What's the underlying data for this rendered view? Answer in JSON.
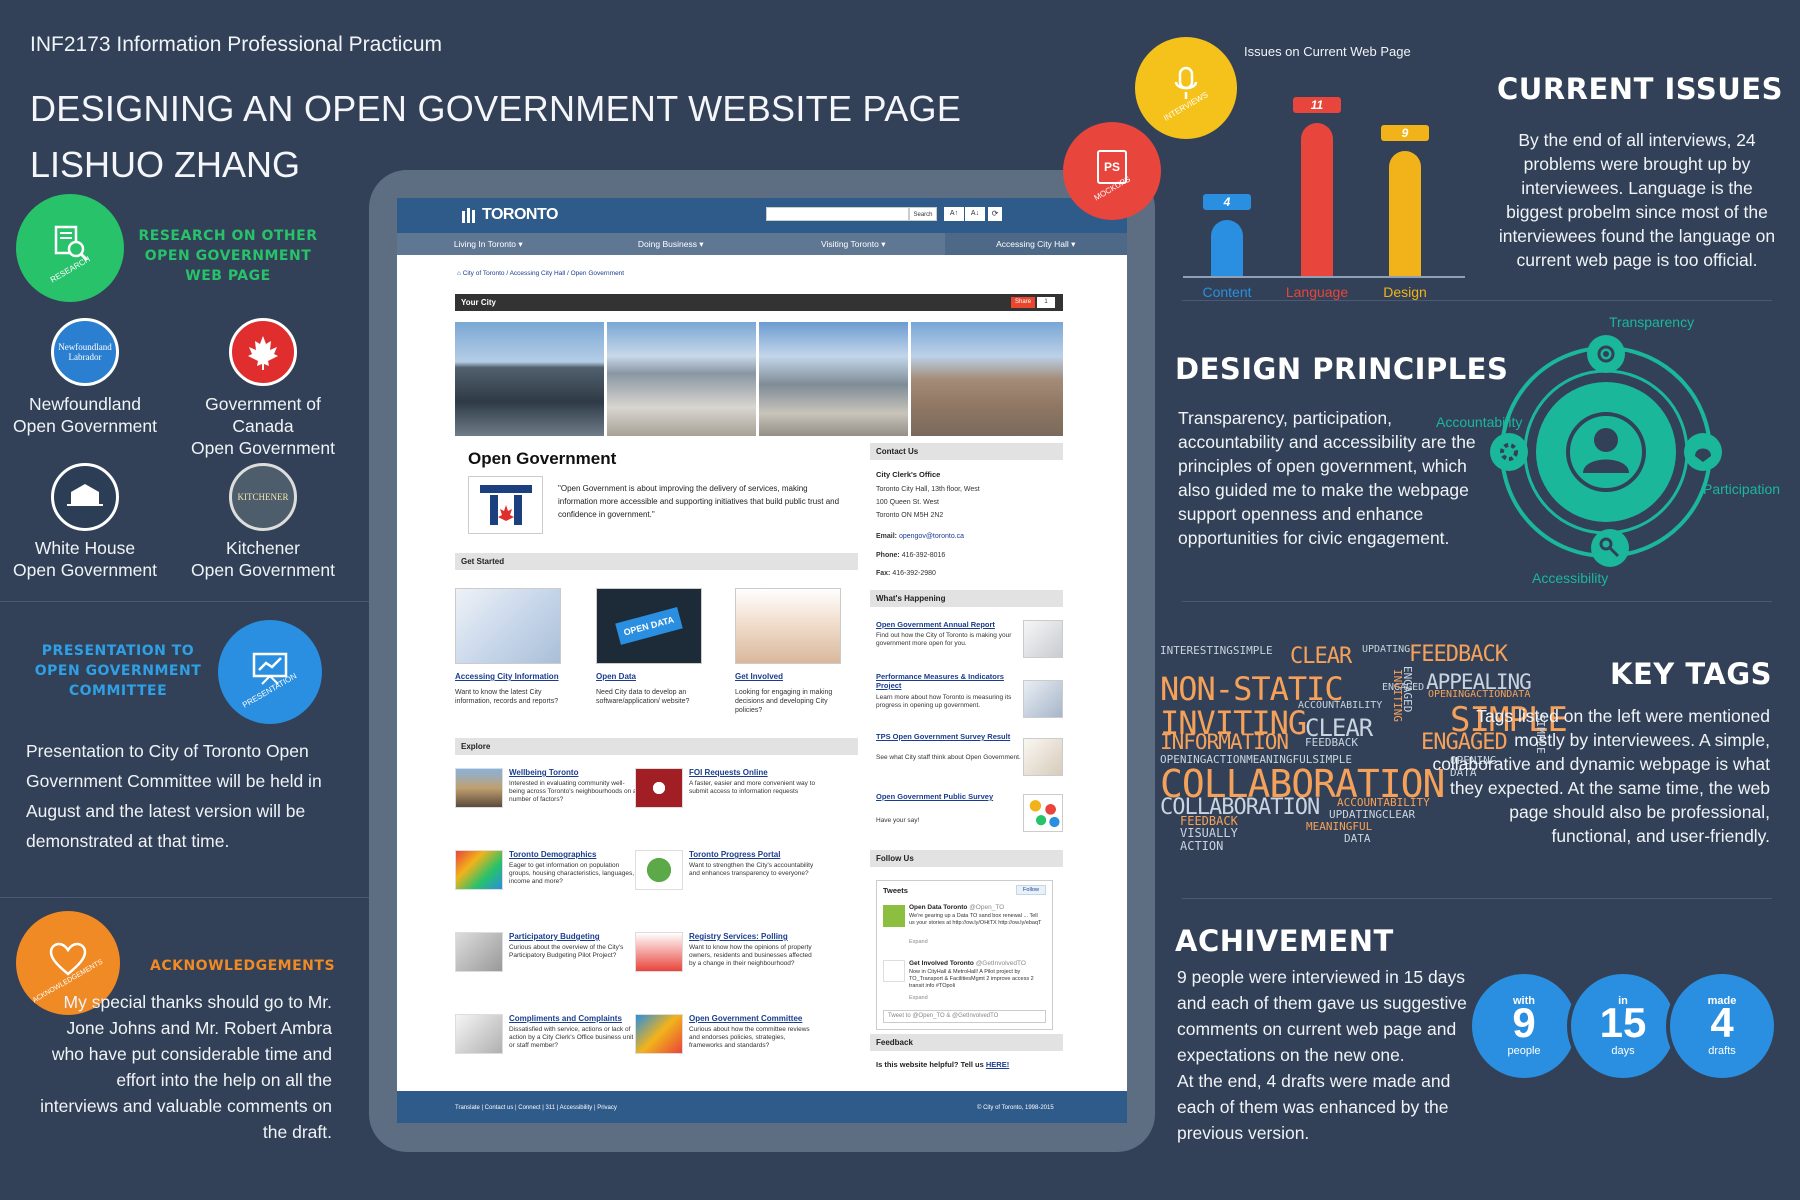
{
  "header": {
    "course": "INF2173 Information Professional Practicum",
    "title": "DESIGNING AN OPEN GOVERNMENT WEBSITE PAGE",
    "author": "LISHUO ZHANG"
  },
  "research": {
    "badge": "RESEARCH",
    "title": "RESEARCH ON OTHER\nOPEN GOVERNMENT\nWEB PAGE",
    "logos": [
      {
        "l1": "Newfoundland",
        "l2": "Open Government",
        "icon": "Newfoundland Labrador"
      },
      {
        "l1": "Government of Canada",
        "l2": "Open Government",
        "icon": "maple-leaf"
      },
      {
        "l1": "White House",
        "l2": "Open Government",
        "icon": "THE WHITE HOUSE"
      },
      {
        "l1": "Kitchener",
        "l2": "Open Government",
        "icon": "KITCHENER"
      }
    ]
  },
  "presentation": {
    "badge": "PRESENTATION",
    "title": "PRESENTATION TO\nOPEN GOVERNMENT\nCOMMITTEE",
    "text": "Presentation to City of Toronto Open Government Committee will be held in August and the latest version will be demonstrated at that time."
  },
  "ack": {
    "badge": "ACKNOWLEDGEMENTS",
    "title": "ACKNOWLEDGEMENTS",
    "text": "My special thanks should go to Mr. Jone Johns and Mr. Robert Ambra who have put considerable time and effort into the help on all the interviews and valuable comments on the draft."
  },
  "badges": {
    "interviews": "INTERVIEWS",
    "mockups": "MOCKUPS",
    "ps": "PS"
  },
  "site": {
    "logo": "TORONTO",
    "search_placeholder": "",
    "search_btn": "Search",
    "font_up": "A↑",
    "font_down": "A↓",
    "nav": [
      "Living In Toronto ▾",
      "Doing Business ▾",
      "Visiting Toronto ▾",
      "Accessing City Hall ▾"
    ],
    "breadcrumb": "⌂  City of Toronto  /  Accessing City Hall  /  Open Government",
    "yourcity": "Your City",
    "share": "Share",
    "share_count": "1",
    "page_title": "Open Government",
    "quote": "\"Open Government is about improving the delivery of services, making information more accessible and supporting initiatives that build public trust and confidence in government.\"",
    "contact": {
      "header": "Contact Us",
      "office": "City Clerk's Office",
      "addr1": "Toronto City Hall, 13th floor, West",
      "addr2": "100 Queen St. West",
      "addr3": "Toronto ON M5H 2N2",
      "email_lbl": "Email:",
      "email": "opengov@toronto.ca",
      "phone_lbl": "Phone:",
      "phone": "416-392-8016",
      "fax_lbl": "Fax:",
      "fax": "416-392-2980"
    },
    "get_started": {
      "header": "Get Started",
      "items": [
        {
          "title": "Accessing City Information",
          "desc": "Want to know the latest City information, records and reports?"
        },
        {
          "title": "Open Data",
          "desc": "Need City data to develop an software/application/ website?"
        },
        {
          "title": "Get Involved",
          "desc": "Looking for engaging in making decisions and developing City policies?"
        }
      ],
      "open_data_img": "OPEN DATA"
    },
    "happening": {
      "header": "What's Happening",
      "items": [
        {
          "title": "Open Government Annual Report",
          "desc": "Find out how the City of Toronto is making your government more open for you."
        },
        {
          "title": "Performance Measures & Indicators Project",
          "desc": "Learn more about how Toronto is measuring its progress in opening up government."
        },
        {
          "title": "TPS Open Government Survey Result",
          "desc": "See what City staff think about Open Government."
        },
        {
          "title": "Open Government Public Survey",
          "desc": "Have your say!"
        }
      ]
    },
    "explore": {
      "header": "Explore",
      "items": [
        {
          "title": "Wellbeing Toronto",
          "desc": "Interested in evaluating community well-being across Toronto's neighbourhoods on a number of factors?"
        },
        {
          "title": "FOI Requests Online",
          "desc": "A faster, easier and more convenient way to submit access to information requests"
        },
        {
          "title": "Toronto Demographics",
          "desc": "Eager to get information on population groups, housing characteristics, languages, income and more?"
        },
        {
          "title": "Toronto Progress Portal",
          "desc": "Want to strengthen the City's accountability and enhances transparency to everyone?"
        },
        {
          "title": "Participatory Budgeting",
          "desc": "Curious about the overview of the City's Participatory Budgeting Pilot Project?"
        },
        {
          "title": "Registry Services: Polling",
          "desc": "Want to know how the opinions of property owners, residents and businesses affected by a change in their neighbourhood?"
        },
        {
          "title": "Compliments and Complaints",
          "desc": "Dissatisfied with service, actions or lack of action by a City Clerk's Office business unit or staff member?"
        },
        {
          "title": "Open Government Committee",
          "desc": "Curious about how the committee reviews and endorses policies, strategies, frameworks and standards?"
        }
      ]
    },
    "follow": {
      "header": "Follow Us",
      "tweets_title": "Tweets",
      "follow_btn": "Follow",
      "tweet1_name": "Open Data Toronto",
      "tweet1_handle": "@Open_TO",
      "tweet1_text": "We're gearing up a Data TO sand box renewal ... Tell us your stories at http://ow.ly/OHtTX http://ow.ly/ebaqT",
      "tweet1_expand": "Expand",
      "tweet2_name": "Get Involved Toronto",
      "tweet2_handle": "@GetInvolvedTO",
      "tweet2_text": "Now in CityHall & MetroHall! A Pilot project by TO_Transport & FacilitiesMgmt 2 improve access 2 transit info #TOpoli",
      "tweet2_expand": "Expand",
      "tweet_box": "Tweet to @Open_TO & @GetInvolvedTO"
    },
    "feedback": {
      "header": "Feedback",
      "text": "Is this website helpful? Tell us",
      "link": "HERE!"
    },
    "footer": {
      "links": "Translate  |  Contact us  |  Connect  |  311  |  Accessibility  |  Privacy",
      "copyright": "© City of Toronto, 1998-2015"
    }
  },
  "issues": {
    "chart_title": "Issues on Current Web Page",
    "title": "CURRENT ISSUES",
    "text": "By the end of all interviews, 24 problems were brought up by interviewees. Language is the biggest probelm since most of the interviewees found the language on current web page is too official."
  },
  "chart_data": {
    "type": "bar",
    "title": "Issues on Current Web Page",
    "categories": [
      "Content",
      "Language",
      "Design"
    ],
    "values": [
      4,
      11,
      9
    ],
    "colors": [
      "#2a8fe0",
      "#e8453c",
      "#f2b31a"
    ],
    "ylim": [
      0,
      11
    ]
  },
  "principles": {
    "title": "DESIGN PRINCIPLES",
    "text": "Transparency, participation, accountability and accessibility are the principles of open government, which also guided me to make the webpage support openness and enhance opportunities for civic engagement.",
    "labels": {
      "transparency": "Transparency",
      "accountability": "Accountability",
      "participation": "Participation",
      "accessibility": "Accessibility"
    },
    "color": "#1bb79b"
  },
  "tags": {
    "title": "KEY TAGS",
    "text": "Tags listed on the left were mentioned mostly by interviewees. A simple, collaborative and dynamic webpage is what they expected. At the same time, the web page should also be professional, functional, and user-friendly.",
    "words": [
      "INTERESTINGSIMPLE",
      "CLEAR",
      "UPDATING",
      "FEEDBACK",
      "NON-STATIC",
      "APPEALING",
      "ENGAGED",
      "ACCOUNTABILITY",
      "OPENINGACTIONDATA",
      "INVITING",
      "CLEAR",
      "SIMPLE",
      "INFORMATION",
      "FEEDBACK",
      "ENGAGED",
      "OPENINGACTIONMEANINGFULSIMPLE",
      "OPENING",
      "COLLABORATION",
      "DATA",
      "COLLABORATION",
      "ACCOUNTABILITY",
      "FEEDBACK",
      "UPDATINGCLEAR",
      "VISUALLY",
      "MEANINGFUL",
      "ACTION",
      "DATA",
      "INVITING",
      "ENGAGED",
      "SIMPLE"
    ]
  },
  "achievement": {
    "title": "ACHIVEMENT",
    "text1": "9 people were interviewed in 15 days and each of them gave us suggestive comments on current web page and expectations on the new one.",
    "text2": "At the end, 4 drafts were made and each of them was enhanced by the previous version.",
    "stats": [
      {
        "top": "with",
        "num": "9",
        "bot": "people"
      },
      {
        "top": "in",
        "num": "15",
        "bot": "days"
      },
      {
        "top": "made",
        "num": "4",
        "bot": "drafts"
      }
    ]
  }
}
